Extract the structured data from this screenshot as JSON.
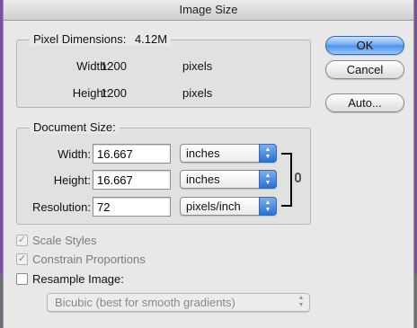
{
  "window": {
    "title": "Image Size"
  },
  "pixel_dimensions": {
    "title": "Pixel Dimensions:",
    "size": "4.12M",
    "width_label": "Width:",
    "width_value": "1200",
    "width_unit": "pixels",
    "height_label": "Height:",
    "height_value": "1200",
    "height_unit": "pixels"
  },
  "document_size": {
    "title": "Document Size:",
    "width_label": "Width:",
    "width_value": "16.667",
    "width_unit": "inches",
    "height_label": "Height:",
    "height_value": "16.667",
    "height_unit": "inches",
    "resolution_label": "Resolution:",
    "resolution_value": "72",
    "resolution_unit": "pixels/inch"
  },
  "buttons": {
    "ok": "OK",
    "cancel": "Cancel",
    "auto": "Auto..."
  },
  "options": {
    "scale_styles": {
      "label": "Scale Styles",
      "checked": true,
      "enabled": false
    },
    "constrain_proportions": {
      "label": "Constrain Proportions",
      "checked": true,
      "enabled": false
    },
    "resample_image": {
      "label": "Resample Image:",
      "checked": false,
      "enabled": true
    },
    "resample_method": "Bicubic (best for smooth gradients)"
  },
  "icons": {
    "link": "chain-link-icon",
    "dropdown": "updown-arrows-icon",
    "check": "checkmark-icon"
  },
  "colors": {
    "accent": "#4b90ea",
    "background": "#7a4fa0"
  }
}
